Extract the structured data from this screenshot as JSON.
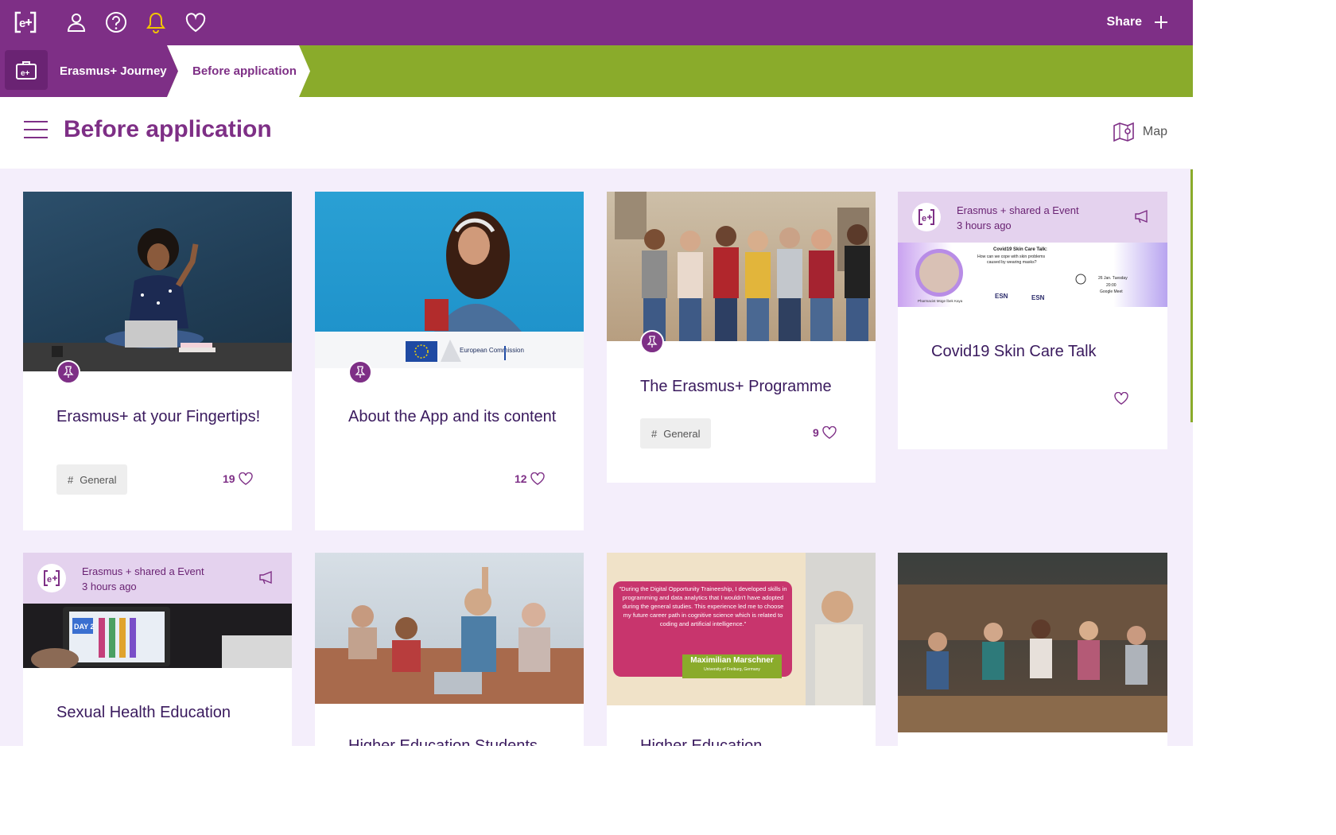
{
  "topbar": {
    "share_label": "Share",
    "icons": [
      "erasmus-logo-icon",
      "user-icon",
      "help-icon",
      "bell-icon",
      "heart-icon"
    ],
    "bell_color": "#f2c500"
  },
  "breadcrumb": {
    "items": [
      {
        "label": "Erasmus+ Journey"
      },
      {
        "label": "Before application"
      }
    ]
  },
  "page": {
    "title": "Before application",
    "map_label": "Map"
  },
  "colors": {
    "brand_purple": "#7e2f86",
    "brand_green": "#8aab2b",
    "background": "#f4eefb"
  },
  "cards": [
    {
      "title": "Erasmus+ at your Fingertips!",
      "tag": "General",
      "likes": "19",
      "pinned": true,
      "image": "woman-with-laptop-pointing-photo"
    },
    {
      "title": "About the App and its content",
      "likes": "12",
      "pinned": true,
      "image": "student-with-headphones-photo",
      "logo_text": "European Commission"
    },
    {
      "title": "The Erasmus+ Programme",
      "tag": "General",
      "likes": "9",
      "pinned": true,
      "image": "group-of-students-walking-photo"
    },
    {
      "title": "Covid19 Skin Care Talk",
      "shared_by": "Erasmus + shared a Event",
      "time": "3 hours ago",
      "banner_headline": "Covid19 Skin Care Talk:",
      "banner_question": "How can we cope with skin problems caused by wearing masks?",
      "banner_date": "26 Jan. Tuesday",
      "banner_time": "20:00",
      "banner_platform": "Google Meet",
      "banner_speaker": "Pharmacist Müge İbek Kaya",
      "banner_org": "ESN"
    },
    {
      "title": "Sexual Health Education",
      "shared_by": "Erasmus + shared a Event",
      "time": "3 hours ago",
      "image": "tablet-day-2-photo",
      "image_text": "DAY 2"
    },
    {
      "title": "Higher Education Students",
      "image": "lecture-hall-students-photo"
    },
    {
      "title": "Higher Education",
      "image": "testimonial-quote-photo",
      "quote": "\"During the Digital Opportunity Traineeship, I developed skills in programming and data analytics that I wouldn't have adopted during the general studies. This experience led me to choose my future career path in cognitive science which is related to coding and artificial intelligence.\"",
      "person": "Maximilian Marschner",
      "affiliation": "University of Freiburg, Germany"
    },
    {
      "image": "students-in-library-circle-photo"
    }
  ]
}
